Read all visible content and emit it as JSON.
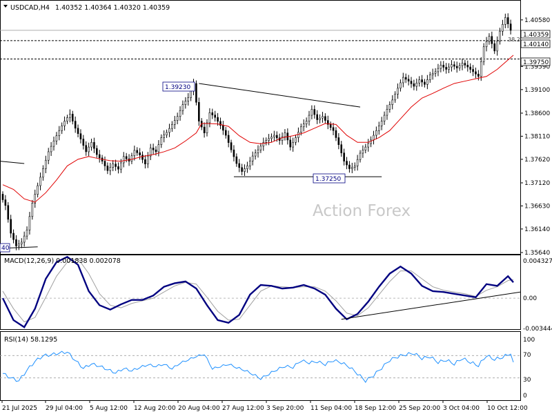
{
  "header": {
    "symbol": "USDCAD,H4",
    "ohlc": "1.40352 1.40364 1.40320 1.40359"
  },
  "watermark": "Action Forex",
  "price_labels": {
    "current": "1.40359",
    "level_a": "1.40140",
    "level_b": "1.39750",
    "fib_text": "38.2",
    "peak": "1.39230",
    "trough": "1.37250",
    "left_edge": "40"
  },
  "macd": {
    "label": "MACD(12,26,9) 0.001838 0.002078",
    "ticks": [
      "0.004327",
      "0.00",
      "-0.003444"
    ]
  },
  "rsi": {
    "label": "RSI(14) 58.1295",
    "ticks": [
      "100",
      "70",
      "30",
      "0"
    ]
  },
  "colors": {
    "ma": "#e00000",
    "macd": "#000080",
    "signal": "#a0a0a0",
    "rsi": "#1e90ff",
    "candle": "#000000"
  },
  "chart_data": [
    {
      "type": "line",
      "panel": "price",
      "symbol": "USDCAD",
      "timeframe": "H4",
      "ylim": [
        1.3564,
        1.409
      ],
      "yticks": [
        "1.40580",
        "1.40090",
        "1.39590",
        "1.39100",
        "1.38600",
        "1.38110",
        "1.37620",
        "1.37120",
        "1.36630",
        "1.36140",
        "1.35640"
      ],
      "xticks": [
        "21 Jul 2025",
        "29 Jul 04:00",
        "5 Aug 12:00",
        "12 Aug 20:00",
        "20 Aug 04:00",
        "27 Aug 12:00",
        "3 Sep 20:00",
        "11 Sep 04:00",
        "18 Sep 12:00",
        "25 Sep 20:00",
        "3 Oct 04:00",
        "10 Oct 12:00"
      ],
      "series": [
        {
          "role": "price",
          "x": [
            0,
            2,
            4,
            6,
            8,
            10,
            12,
            14,
            16,
            18,
            20,
            22,
            24,
            26,
            28,
            30,
            32,
            34,
            36,
            38,
            40,
            42,
            44,
            46,
            48,
            50,
            52,
            54,
            56,
            58,
            60,
            62,
            64,
            66,
            68,
            70,
            72,
            74,
            76,
            78,
            80,
            82,
            84,
            86,
            88,
            90,
            92,
            94,
            96,
            98,
            100,
            102,
            104,
            106,
            108,
            110,
            112,
            114,
            116,
            118,
            120,
            122,
            124,
            126,
            128,
            130,
            132,
            134,
            136,
            138,
            140,
            142,
            144,
            146,
            148,
            150,
            152,
            154,
            156,
            158,
            160,
            162,
            164,
            166,
            168,
            170,
            172,
            174,
            176,
            178,
            180,
            182,
            184,
            186,
            188,
            190
          ],
          "values": [
            1.3688,
            1.3664,
            1.3605,
            1.3578,
            1.3586,
            1.3612,
            1.3669,
            1.3706,
            1.3742,
            1.3778,
            1.3801,
            1.3823,
            1.3843,
            1.3858,
            1.3828,
            1.3805,
            1.3778,
            1.3798,
            1.3772,
            1.3758,
            1.3738,
            1.3752,
            1.3741,
            1.3768,
            1.3758,
            1.3781,
            1.3771,
            1.3752,
            1.3786,
            1.3778,
            1.3808,
            1.3819,
            1.3836,
            1.3853,
            1.3878,
            1.3893,
            1.3923,
            1.3843,
            1.3818,
            1.3861,
            1.3851,
            1.3834,
            1.3813,
            1.3782,
            1.3753,
            1.3736,
            1.3748,
            1.3769,
            1.3782,
            1.3798,
            1.3806,
            1.3813,
            1.3802,
            1.3818,
            1.3788,
            1.3808,
            1.3831,
            1.3843,
            1.3868,
            1.3846,
            1.3853,
            1.3836,
            1.3823,
            1.3793,
            1.3758,
            1.3742,
            1.3748,
            1.3775,
            1.3788,
            1.3803,
            1.3823,
            1.3843,
            1.3868,
            1.3888,
            1.3913,
            1.3936,
            1.3928,
            1.3917,
            1.3931,
            1.3921,
            1.3941,
            1.3948,
            1.3962,
            1.3953,
            1.3963,
            1.3956,
            1.3966,
            1.3958,
            1.3948,
            1.3938,
            1.4001,
            1.4023,
            1.3992,
            1.4034,
            1.4063,
            1.4036
          ]
        },
        {
          "role": "moving-average",
          "x": [
            0,
            4,
            8,
            12,
            16,
            20,
            24,
            28,
            32,
            36,
            40,
            44,
            48,
            52,
            56,
            60,
            64,
            68,
            72,
            74,
            76,
            80,
            84,
            88,
            92,
            96,
            100,
            104,
            108,
            112,
            116,
            120,
            124,
            128,
            132,
            136,
            140,
            144,
            148,
            152,
            156,
            160,
            164,
            168,
            172,
            176,
            180,
            184,
            188,
            190
          ],
          "values": [
            1.3708,
            1.3698,
            1.3678,
            1.3671,
            1.3691,
            1.3718,
            1.3748,
            1.3762,
            1.3768,
            1.3763,
            1.3759,
            1.3758,
            1.3762,
            1.3768,
            1.3772,
            1.3778,
            1.3786,
            1.3801,
            1.3818,
            1.3838,
            1.3838,
            1.3837,
            1.3832,
            1.3812,
            1.3798,
            1.3795,
            1.3798,
            1.3808,
            1.3812,
            1.3818,
            1.3828,
            1.3838,
            1.3836,
            1.3813,
            1.3798,
            1.3798,
            1.3808,
            1.3823,
            1.3848,
            1.3873,
            1.3892,
            1.3902,
            1.3913,
            1.3923,
            1.3928,
            1.3933,
            1.3938,
            1.3953,
            1.3973,
            1.3983
          ]
        }
      ]
    },
    {
      "type": "line",
      "panel": "macd",
      "ylim": [
        -0.003444,
        0.004327
      ],
      "series": [
        {
          "role": "macd",
          "x": [
            0,
            4,
            8,
            12,
            16,
            20,
            24,
            28,
            32,
            36,
            40,
            44,
            48,
            52,
            56,
            60,
            64,
            68,
            72,
            76,
            80,
            84,
            88,
            92,
            96,
            100,
            104,
            108,
            112,
            116,
            120,
            124,
            128,
            132,
            136,
            140,
            144,
            148,
            152,
            156,
            160,
            164,
            168,
            172,
            176,
            180,
            184,
            188,
            190
          ],
          "values": [
            0.0,
            -0.0025,
            -0.0033,
            -0.0012,
            0.0022,
            0.0041,
            0.0047,
            0.0038,
            0.0008,
            -0.0008,
            -0.0013,
            -0.0007,
            -0.0002,
            -0.0002,
            0.0003,
            0.0013,
            0.0017,
            0.0019,
            0.0011,
            -0.0008,
            -0.0025,
            -0.0028,
            -0.0019,
            0.0004,
            0.0015,
            0.0014,
            0.0011,
            0.0012,
            0.0015,
            0.0011,
            0.0004,
            -0.0012,
            -0.0024,
            -0.0018,
            -0.0004,
            0.0013,
            0.0028,
            0.0036,
            0.0028,
            0.0014,
            0.0008,
            0.0007,
            0.0005,
            0.0003,
            0.0001,
            0.0016,
            0.0014,
            0.0025,
            0.0018
          ]
        },
        {
          "role": "signal",
          "x": [
            0,
            4,
            8,
            12,
            16,
            20,
            24,
            28,
            32,
            36,
            40,
            44,
            48,
            52,
            56,
            60,
            64,
            68,
            72,
            76,
            80,
            84,
            88,
            92,
            96,
            100,
            104,
            108,
            112,
            116,
            120,
            124,
            128,
            132,
            136,
            140,
            144,
            148,
            152,
            156,
            160,
            164,
            168,
            172,
            176,
            180,
            184,
            188,
            190
          ],
          "values": [
            0.0008,
            -0.0012,
            -0.0027,
            -0.0022,
            0.0001,
            0.0025,
            0.0041,
            0.0045,
            0.0028,
            0.0005,
            -0.0008,
            -0.0011,
            -0.0006,
            -0.0003,
            0.0,
            0.0007,
            0.0014,
            0.0018,
            0.0016,
            0.0001,
            -0.0015,
            -0.0025,
            -0.0024,
            -0.0008,
            0.0008,
            0.0014,
            0.0013,
            0.0012,
            0.0013,
            0.0013,
            0.0008,
            -0.0003,
            -0.0017,
            -0.002,
            -0.0011,
            0.0004,
            0.0019,
            0.0031,
            0.0031,
            0.0022,
            0.0013,
            0.0009,
            0.0007,
            0.0005,
            0.0002,
            0.0009,
            0.0013,
            0.002,
            0.0021
          ]
        }
      ]
    },
    {
      "type": "line",
      "panel": "rsi",
      "ylim": [
        0,
        100
      ],
      "series": [
        {
          "role": "rsi",
          "x": [
            0,
            3,
            6,
            9,
            12,
            15,
            18,
            21,
            24,
            27,
            30,
            33,
            36,
            39,
            42,
            45,
            48,
            51,
            54,
            57,
            60,
            63,
            66,
            69,
            72,
            75,
            78,
            81,
            84,
            87,
            90,
            93,
            96,
            99,
            102,
            105,
            108,
            111,
            114,
            117,
            120,
            123,
            126,
            129,
            132,
            135,
            138,
            141,
            144,
            147,
            150,
            153,
            156,
            159,
            162,
            165,
            168,
            171,
            174,
            177,
            180,
            183,
            186,
            189,
            190
          ],
          "values": [
            38,
            30,
            25,
            44,
            60,
            70,
            72,
            75,
            77,
            62,
            48,
            56,
            52,
            46,
            40,
            48,
            44,
            50,
            55,
            52,
            56,
            48,
            58,
            64,
            70,
            74,
            48,
            52,
            56,
            50,
            45,
            38,
            30,
            38,
            46,
            52,
            50,
            62,
            58,
            60,
            55,
            62,
            58,
            50,
            38,
            25,
            35,
            48,
            62,
            68,
            72,
            74,
            65,
            68,
            58,
            62,
            55,
            65,
            58,
            52,
            70,
            63,
            67,
            74,
            58
          ]
        }
      ]
    }
  ]
}
